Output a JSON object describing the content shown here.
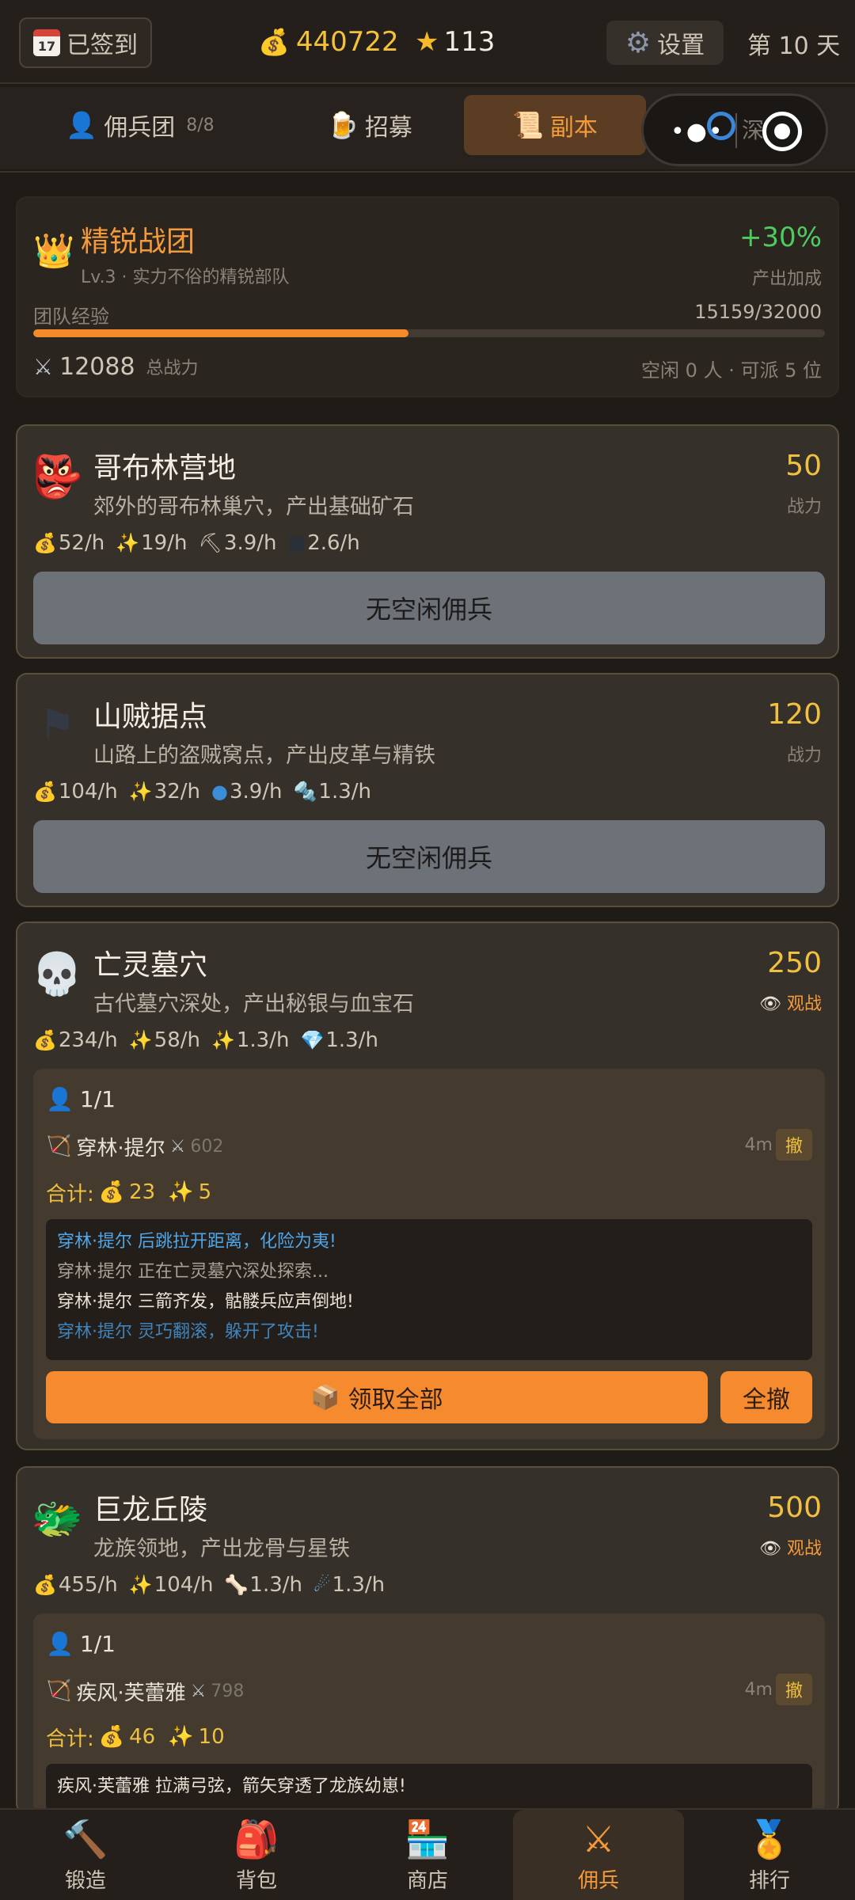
{
  "header": {
    "checkin_label": "已签到",
    "checkin_icon": "calendar-icon",
    "calendar_day": "17",
    "coins": "440722",
    "stars": "113",
    "settings_label": "设置",
    "day_label": "第 10 天"
  },
  "tabs": [
    {
      "label": "佣兵团",
      "count": "8/8",
      "icon": "mercenary-icon"
    },
    {
      "label": "招募",
      "icon": "beer-icon"
    },
    {
      "label": "副本",
      "icon": "scroll-icon",
      "active": true
    },
    {
      "label": "深",
      "icon": "swirl-icon"
    }
  ],
  "team": {
    "name": "精锐战团",
    "subtitle": "Lv.3 · 实力不俗的精锐部队",
    "bonus": "+30%",
    "bonus_label": "产出加成",
    "exp_label": "团队经验",
    "exp_value": "15159/32000",
    "exp_fraction": 0.4737,
    "power": "12088",
    "power_label": "总战力",
    "idle_info": "空闲 0 人 · 可派 5 位"
  },
  "dungeons": [
    {
      "name": "哥布林营地",
      "desc": "郊外的哥布林巢穴，产出基础矿石",
      "power": "50",
      "power_label": "战力",
      "yields": [
        "52/h",
        "19/h",
        "3.9/h",
        "2.6/h"
      ],
      "button": "无空闲佣兵"
    },
    {
      "name": "山贼据点",
      "desc": "山路上的盗贼窝点，产出皮革与精铁",
      "power": "120",
      "power_label": "战力",
      "yields": [
        "104/h",
        "32/h",
        "3.9/h",
        "1.3/h"
      ],
      "button": "无空闲佣兵"
    },
    {
      "name": "亡灵墓穴",
      "desc": "古代墓穴深处，产出秘银与血宝石",
      "power": "250",
      "watch_label": "观战",
      "yields": [
        "234/h",
        "58/h",
        "1.3/h",
        "1.3/h"
      ],
      "squad_count": "1/1",
      "merc_name": "穿林·提尔",
      "merc_power": "602",
      "merc_time": "4m",
      "withdraw_label": "撤",
      "total_label": "合计:",
      "total_coins": "23",
      "total_sparkle": "5",
      "log": [
        "穿林·提尔 后跳拉开距离，化险为夷!",
        "穿林·提尔 正在亡灵墓穴深处探索...",
        "穿林·提尔 三箭齐发，骷髅兵应声倒地!",
        "穿林·提尔 灵巧翻滚，躲开了攻击!"
      ],
      "claim_label": "领取全部",
      "withdraw_all_label": "全撤"
    },
    {
      "name": "巨龙丘陵",
      "desc": "龙族领地，产出龙骨与星铁",
      "power": "500",
      "watch_label": "观战",
      "yields": [
        "455/h",
        "104/h",
        "1.3/h",
        "1.3/h"
      ],
      "squad_count": "1/1",
      "merc_name": "疾风·芙蕾雅",
      "merc_power": "798",
      "merc_time": "4m",
      "withdraw_label": "撤",
      "total_label": "合计:",
      "total_coins": "46",
      "total_sparkle": "10",
      "log": [
        "疾风·芙蕾雅 拉满弓弦，箭矢穿透了龙族幼崽!"
      ]
    }
  ],
  "bottom_nav": [
    {
      "label": "锻造",
      "icon": "hammer-icon"
    },
    {
      "label": "背包",
      "icon": "backpack-icon"
    },
    {
      "label": "商店",
      "icon": "shop-icon"
    },
    {
      "label": "佣兵",
      "icon": "crossed-swords-icon",
      "active": true
    },
    {
      "label": "排行",
      "icon": "medal-icon"
    }
  ],
  "colors": {
    "accent": "#f59a3a",
    "gold": "#f0c040",
    "bonus_green": "#4ecb5e",
    "background": "#1f1b17"
  }
}
